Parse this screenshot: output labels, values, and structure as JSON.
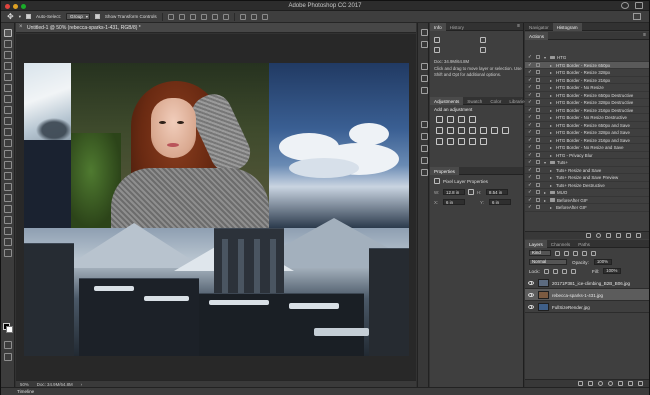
{
  "app": {
    "title": "Adobe Photoshop CC 2017"
  },
  "options_bar": {
    "auto_select_label": "Auto-Select:",
    "auto_select_value": "Group",
    "transform_label": "Show Transform Controls"
  },
  "document": {
    "tab_title": "Untitled-1 @ 50% (rebecca-sparks-1-431, RGB/8) *",
    "zoom": "50%",
    "doc_size": "Doc: 34.9M/64.8M"
  },
  "timeline": {
    "label": "Timeline"
  },
  "info_panel": {
    "tabs": [
      "Info",
      "History"
    ],
    "doc_size": "Doc: 34.9M/64.8M",
    "hint": "Click and drag to move layer or selection. Use Shift and Opt for additional options."
  },
  "adjustments_panel": {
    "tabs": [
      "Adjustments",
      "Swatch",
      "Color",
      "Librarie"
    ],
    "subtitle": "Add an adjustment"
  },
  "properties_panel": {
    "tabs": [
      "Properties"
    ],
    "section": "Pixel Layer Properties",
    "w_label": "W:",
    "w_value": "12.8 in",
    "h_label": "H:",
    "h_value": "8.54 in",
    "x_label": "X:",
    "x_value": "6 in",
    "y_label": "Y:",
    "y_value": "6 in"
  },
  "actions_panel": {
    "tabs": [
      "Navigator",
      "Histogram"
    ],
    "second_tabs": [
      "Actions"
    ],
    "rows": [
      {
        "label": "HTG",
        "kind": "set",
        "expanded": true
      },
      {
        "label": "HTG Border - Resize 650px",
        "kind": "action"
      },
      {
        "label": "HTG Border - Resize 328px",
        "kind": "action"
      },
      {
        "label": "HTG Border - Resize 216px",
        "kind": "action"
      },
      {
        "label": "HTG Border - No Resize",
        "kind": "action"
      },
      {
        "label": "HTG Border - Resize 650px Destructive",
        "kind": "action"
      },
      {
        "label": "HTG Border - Resize 328px Destructive",
        "kind": "action"
      },
      {
        "label": "HTG Border - Resize 216px Destructive",
        "kind": "action"
      },
      {
        "label": "HTG Border - No Resize Destructive",
        "kind": "action"
      },
      {
        "label": "HTG Border - Resize 650px and Save",
        "kind": "action"
      },
      {
        "label": "HTG Border - Resize 328px and Save",
        "kind": "action"
      },
      {
        "label": "HTG Border - Resize 216px and Save",
        "kind": "action"
      },
      {
        "label": "HTG Border - No Resize and Save",
        "kind": "action"
      },
      {
        "label": "HTG - Privacy Blur",
        "kind": "action"
      },
      {
        "label": "Tuts+",
        "kind": "set",
        "expanded": true
      },
      {
        "label": "Tuts+ Resize and Save",
        "kind": "action"
      },
      {
        "label": "Tuts+ Resize and Save Preview",
        "kind": "action"
      },
      {
        "label": "Tuts+ Resize Destructive",
        "kind": "action"
      },
      {
        "label": "MUO",
        "kind": "set",
        "expanded": false
      },
      {
        "label": "BeforeAfter GIF",
        "kind": "set",
        "expanded": false
      },
      {
        "label": "BeforeAfter GIF",
        "kind": "action"
      }
    ]
  },
  "layers_panel": {
    "tabs": [
      "Layers",
      "Channels",
      "Paths"
    ],
    "kind_label": "Kind",
    "blend_mode": "Normal",
    "opacity_label": "Opacity:",
    "opacity_value": "100%",
    "lock_label": "Lock:",
    "fill_label": "Fill:",
    "fill_value": "100%",
    "layers": [
      {
        "name": "20171P381_ice-climbing_B2B_B06.jpg",
        "selected": false,
        "thumb": "#5c6b80"
      },
      {
        "name": "rebecca-sparks-1-431.jpg",
        "selected": true,
        "thumb": "#7b5a40"
      },
      {
        "name": "FullSizeRender.jpg",
        "selected": false,
        "thumb": "#3f5f88"
      }
    ]
  },
  "colors": {
    "accent": "#1473e6",
    "panel_bg": "#3f3f3f",
    "canvas_bg": "#282828"
  }
}
